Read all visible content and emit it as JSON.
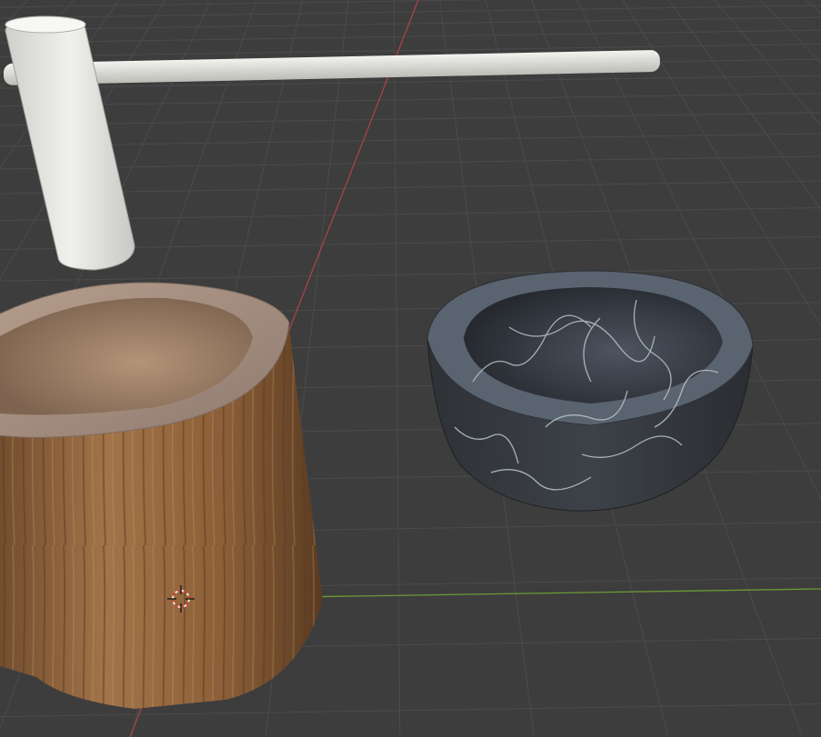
{
  "viewport": {
    "background": "#3d3d3d",
    "grid_color": "#4a4a4a",
    "x_axis_color": "#6f9a3a",
    "y_axis_color": "#b0474d"
  },
  "objects": [
    {
      "name": "mallet",
      "material": "white"
    },
    {
      "name": "wooden-mortar",
      "material": "wood"
    },
    {
      "name": "stone-bowl",
      "material": "marble"
    }
  ],
  "cursor": {
    "name": "3d-cursor"
  }
}
